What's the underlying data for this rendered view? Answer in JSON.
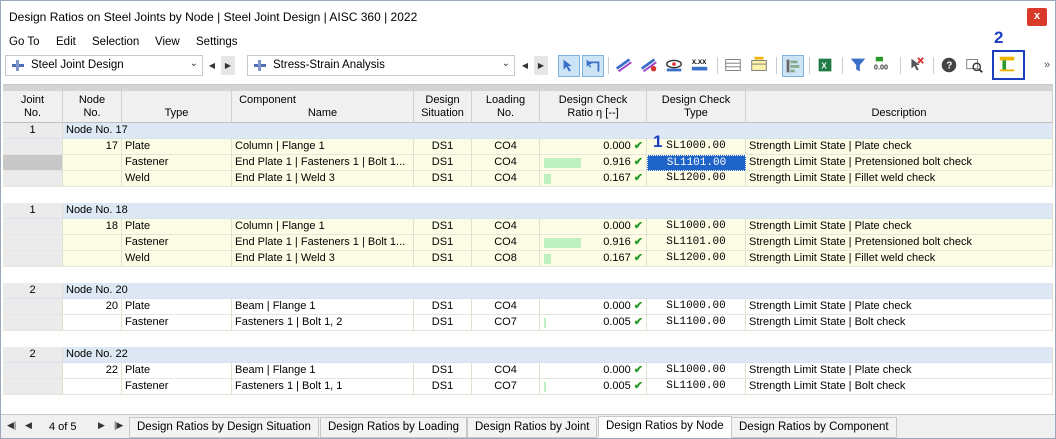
{
  "window": {
    "title": "Design Ratios on Steel Joints by Node | Steel Joint Design | AISC 360 | 2022",
    "close_label": "x"
  },
  "menu": [
    "Go To",
    "Edit",
    "Selection",
    "View",
    "Settings"
  ],
  "toolbar": {
    "module_combo": "Steel Joint Design",
    "analysis_combo": "Stress-Strain Analysis",
    "annotation_1": "1",
    "annotation_2": "2"
  },
  "columns": {
    "joint_no": [
      "Joint",
      "No."
    ],
    "node_no": [
      "Node",
      "No."
    ],
    "component": "Component",
    "type": "Type",
    "name": "Name",
    "design_situation": [
      "Design",
      "Situation"
    ],
    "loading_no": [
      "Loading",
      "No."
    ],
    "ratio": [
      "Design Check",
      "Ratio η [--]"
    ],
    "check_type": [
      "Design Check",
      "Type"
    ],
    "description": "Description"
  },
  "groups": [
    {
      "joint": "1",
      "node_header": "Node No. 17",
      "rows": [
        {
          "node": "17",
          "type": "Plate",
          "name": "Column | Flange 1",
          "ds": "DS1",
          "loading": "CO4",
          "ratio": "0.000",
          "ratio_value": 0.0,
          "check": "SL1000.00",
          "description": "Strength Limit State | Plate check"
        },
        {
          "node": "",
          "type": "Fastener",
          "name": "End Plate 1 | Fasteners 1 | Bolt 1...",
          "ds": "DS1",
          "loading": "CO4",
          "ratio": "0.916",
          "ratio_value": 0.916,
          "check": "SL1101.00",
          "description": "Strength Limit State | Pretensioned bolt check"
        },
        {
          "node": "",
          "type": "Weld",
          "name": "End Plate 1 | Weld 3",
          "ds": "DS1",
          "loading": "CO4",
          "ratio": "0.167",
          "ratio_value": 0.167,
          "check": "SL1200.00",
          "description": "Strength Limit State | Fillet weld check"
        }
      ]
    },
    {
      "joint": "1",
      "node_header": "Node No. 18",
      "rows": [
        {
          "node": "18",
          "type": "Plate",
          "name": "Column | Flange 1",
          "ds": "DS1",
          "loading": "CO4",
          "ratio": "0.000",
          "ratio_value": 0.0,
          "check": "SL1000.00",
          "description": "Strength Limit State | Plate check"
        },
        {
          "node": "",
          "type": "Fastener",
          "name": "End Plate 1 | Fasteners 1 | Bolt 1...",
          "ds": "DS1",
          "loading": "CO4",
          "ratio": "0.916",
          "ratio_value": 0.916,
          "check": "SL1101.00",
          "description": "Strength Limit State | Pretensioned bolt check"
        },
        {
          "node": "",
          "type": "Weld",
          "name": "End Plate 1 | Weld 3",
          "ds": "DS1",
          "loading": "CO8",
          "ratio": "0.167",
          "ratio_value": 0.167,
          "check": "SL1200.00",
          "description": "Strength Limit State | Fillet weld check"
        }
      ]
    },
    {
      "joint": "2",
      "node_header": "Node No. 20",
      "rows": [
        {
          "node": "20",
          "type": "Plate",
          "name": "Beam | Flange 1",
          "ds": "DS1",
          "loading": "CO4",
          "ratio": "0.000",
          "ratio_value": 0.0,
          "check": "SL1000.00",
          "description": "Strength Limit State | Plate check"
        },
        {
          "node": "",
          "type": "Fastener",
          "name": "Fasteners 1 | Bolt 1, 2",
          "ds": "DS1",
          "loading": "CO7",
          "ratio": "0.005",
          "ratio_value": 0.005,
          "check": "SL1100.00",
          "description": "Strength Limit State | Bolt check"
        }
      ]
    },
    {
      "joint": "2",
      "node_header": "Node No. 22",
      "rows": [
        {
          "node": "22",
          "type": "Plate",
          "name": "Beam | Flange 1",
          "ds": "DS1",
          "loading": "CO4",
          "ratio": "0.000",
          "ratio_value": 0.0,
          "check": "SL1000.00",
          "description": "Strength Limit State | Plate check"
        },
        {
          "node": "",
          "type": "Fastener",
          "name": "Fasteners 1 | Bolt 1, 1",
          "ds": "DS1",
          "loading": "CO7",
          "ratio": "0.005",
          "ratio_value": 0.005,
          "check": "SL1100.00",
          "description": "Strength Limit State | Bolt check"
        }
      ]
    }
  ],
  "selected": {
    "group": 0,
    "row": 1
  },
  "pager": {
    "text": "4 of 5"
  },
  "tabs": [
    {
      "label": "Design Ratios by Design Situation",
      "active": false
    },
    {
      "label": "Design Ratios by Loading",
      "active": false
    },
    {
      "label": "Design Ratios by Joint",
      "active": false
    },
    {
      "label": "Design Ratios by Node",
      "active": true
    },
    {
      "label": "Design Ratios by Component",
      "active": false
    }
  ],
  "colors": {
    "accent": "#1a3fbf",
    "selection": "#1e63c8",
    "node_row": "#dde8f4",
    "detail_row": "#fdfde6",
    "ratio_bar": "#bff0bf",
    "check_ok": "#2a9a2a"
  }
}
